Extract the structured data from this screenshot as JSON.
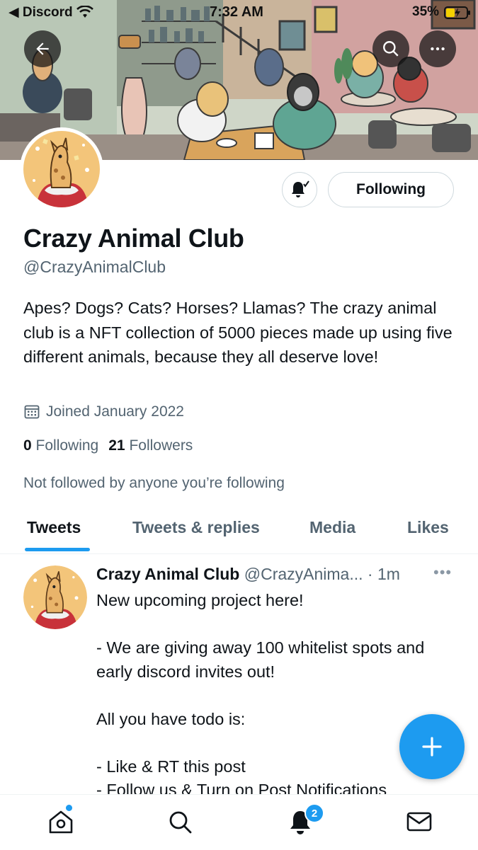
{
  "status_bar": {
    "back_app": "◀ Discord",
    "time": "7:32 AM",
    "battery": "35%"
  },
  "header": {
    "back_icon": "arrow-left-icon",
    "search_icon": "search-icon",
    "more_icon": "more-horizontal-icon"
  },
  "profile": {
    "name": "Crazy Animal Club",
    "handle": "@CrazyAnimalClub",
    "bio": "Apes? Dogs? Cats? Horses? Llamas? The crazy animal club is a NFT collection of 5000 pieces made up using five different animals, because they all deserve love!",
    "joined": "Joined January 2022",
    "following_count": "0",
    "following_label": "Following",
    "followers_count": "21",
    "followers_label": "Followers",
    "not_followed": "Not followed by anyone you’re following",
    "follow_button": "Following",
    "notifications_icon": "bell-subscribed-icon"
  },
  "tabs": [
    {
      "label": "Tweets",
      "active": true
    },
    {
      "label": "Tweets & replies",
      "active": false
    },
    {
      "label": "Media",
      "active": false
    },
    {
      "label": "Likes",
      "active": false
    }
  ],
  "tweet": {
    "name": "Crazy Animal Club",
    "handle": "@CrazyAnima...",
    "time": "· 1m",
    "more": "•••",
    "lines": [
      "New upcoming project here!",
      "",
      "- We are giving away 100 whitelist spots and early discord invites out!",
      "",
      "All you have todo is:",
      "",
      "- Like & RT this post",
      "- Follow us & Turn on Post Notifications"
    ]
  },
  "fab": {
    "icon": "compose-plus-icon"
  },
  "bottom_nav": {
    "home_icon": "home-icon",
    "search_icon": "search-icon",
    "notifications_icon": "bell-icon",
    "notifications_badge": "2",
    "messages_icon": "mail-icon"
  },
  "colors": {
    "accent": "#1d9bf0",
    "text_primary": "#0f1419",
    "text_secondary": "#536471"
  }
}
